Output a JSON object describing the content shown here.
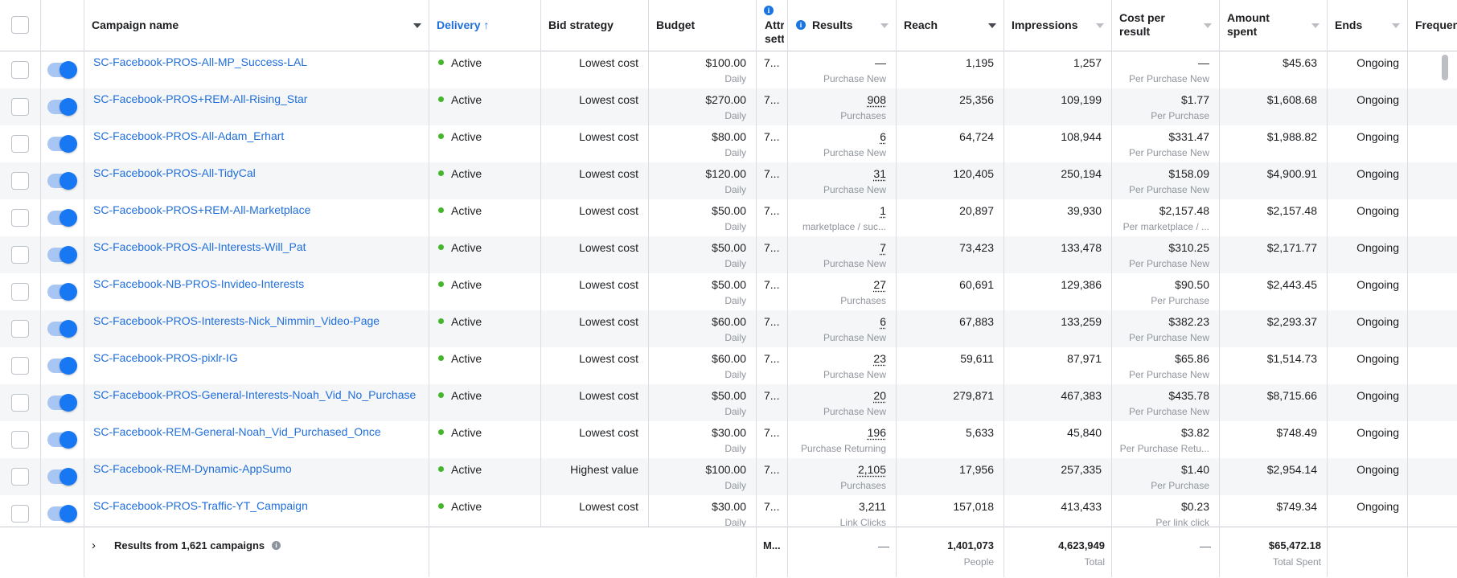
{
  "header": {
    "campaign_name": "Campaign name",
    "delivery": "Delivery",
    "delivery_arrow": "↑",
    "bid_strategy": "Bid strategy",
    "budget": "Budget",
    "attribution_l1": "Attr",
    "attribution_l2": "sett",
    "results": "Results",
    "reach": "Reach",
    "impressions": "Impressions",
    "cost_per_result_l1": "Cost per",
    "cost_per_result_l2": "result",
    "amount_spent_l1": "Amount",
    "amount_spent_l2": "spent",
    "ends": "Ends",
    "frequency": "Frequen",
    "info_glyph": "i"
  },
  "rows": [
    {
      "name": "SC-Facebook-PROS-All-MP_Success-LAL",
      "delivery": "Active",
      "bid": "Lowest cost",
      "budget": "$100.00",
      "budget_type": "Daily",
      "attr": "7...",
      "results": "—",
      "results_sub": "Purchase New",
      "reach": "1,195",
      "impressions": "1,257",
      "cpr": "—",
      "cpr_sub": "Per Purchase New",
      "spent": "$45.63",
      "ends": "Ongoing"
    },
    {
      "name": "SC-Facebook-PROS+REM-All-Rising_Star",
      "delivery": "Active",
      "bid": "Lowest cost",
      "budget": "$270.00",
      "budget_type": "Daily",
      "attr": "7...",
      "results": "908",
      "results_sub": "Purchases",
      "reach": "25,356",
      "impressions": "109,199",
      "cpr": "$1.77",
      "cpr_sub": "Per Purchase",
      "spent": "$1,608.68",
      "ends": "Ongoing"
    },
    {
      "name": "SC-Facebook-PROS-All-Adam_Erhart",
      "delivery": "Active",
      "bid": "Lowest cost",
      "budget": "$80.00",
      "budget_type": "Daily",
      "attr": "7...",
      "results": "6",
      "results_sub": "Purchase New",
      "reach": "64,724",
      "impressions": "108,944",
      "cpr": "$331.47",
      "cpr_sub": "Per Purchase New",
      "spent": "$1,988.82",
      "ends": "Ongoing"
    },
    {
      "name": "SC-Facebook-PROS-All-TidyCal",
      "delivery": "Active",
      "bid": "Lowest cost",
      "budget": "$120.00",
      "budget_type": "Daily",
      "attr": "7...",
      "results": "31",
      "results_sub": "Purchase New",
      "reach": "120,405",
      "impressions": "250,194",
      "cpr": "$158.09",
      "cpr_sub": "Per Purchase New",
      "spent": "$4,900.91",
      "ends": "Ongoing"
    },
    {
      "name": "SC-Facebook-PROS+REM-All-Marketplace",
      "delivery": "Active",
      "bid": "Lowest cost",
      "budget": "$50.00",
      "budget_type": "Daily",
      "attr": "7...",
      "results": "1",
      "results_sub": "marketplace / suc...",
      "reach": "20,897",
      "impressions": "39,930",
      "cpr": "$2,157.48",
      "cpr_sub": "Per marketplace / ...",
      "spent": "$2,157.48",
      "ends": "Ongoing"
    },
    {
      "name": "SC-Facebook-PROS-All-Interests-Will_Pat",
      "delivery": "Active",
      "bid": "Lowest cost",
      "budget": "$50.00",
      "budget_type": "Daily",
      "attr": "7...",
      "results": "7",
      "results_sub": "Purchase New",
      "reach": "73,423",
      "impressions": "133,478",
      "cpr": "$310.25",
      "cpr_sub": "Per Purchase New",
      "spent": "$2,171.77",
      "ends": "Ongoing"
    },
    {
      "name": "SC-Facebook-NB-PROS-Invideo-Interests",
      "delivery": "Active",
      "bid": "Lowest cost",
      "budget": "$50.00",
      "budget_type": "Daily",
      "attr": "7...",
      "results": "27",
      "results_sub": "Purchases",
      "reach": "60,691",
      "impressions": "129,386",
      "cpr": "$90.50",
      "cpr_sub": "Per Purchase",
      "spent": "$2,443.45",
      "ends": "Ongoing"
    },
    {
      "name": "SC-Facebook-PROS-Interests-Nick_Nimmin_Video-Page",
      "delivery": "Active",
      "bid": "Lowest cost",
      "budget": "$60.00",
      "budget_type": "Daily",
      "attr": "7...",
      "results": "6",
      "results_sub": "Purchase New",
      "reach": "67,883",
      "impressions": "133,259",
      "cpr": "$382.23",
      "cpr_sub": "Per Purchase New",
      "spent": "$2,293.37",
      "ends": "Ongoing"
    },
    {
      "name": "SC-Facebook-PROS-pixlr-IG",
      "delivery": "Active",
      "bid": "Lowest cost",
      "budget": "$60.00",
      "budget_type": "Daily",
      "attr": "7...",
      "results": "23",
      "results_sub": "Purchase New",
      "reach": "59,611",
      "impressions": "87,971",
      "cpr": "$65.86",
      "cpr_sub": "Per Purchase New",
      "spent": "$1,514.73",
      "ends": "Ongoing"
    },
    {
      "name": "SC-Facebook-PROS-General-Interests-Noah_Vid_No_Purchase",
      "delivery": "Active",
      "bid": "Lowest cost",
      "budget": "$50.00",
      "budget_type": "Daily",
      "attr": "7...",
      "results": "20",
      "results_sub": "Purchase New",
      "reach": "279,871",
      "impressions": "467,383",
      "cpr": "$435.78",
      "cpr_sub": "Per Purchase New",
      "spent": "$8,715.66",
      "ends": "Ongoing"
    },
    {
      "name": "SC-Facebook-REM-General-Noah_Vid_Purchased_Once",
      "delivery": "Active",
      "bid": "Lowest cost",
      "budget": "$30.00",
      "budget_type": "Daily",
      "attr": "7...",
      "results": "196",
      "results_sub": "Purchase Returning",
      "reach": "5,633",
      "impressions": "45,840",
      "cpr": "$3.82",
      "cpr_sub": "Per Purchase Retu...",
      "spent": "$748.49",
      "ends": "Ongoing"
    },
    {
      "name": "SC-Facebook-REM-Dynamic-AppSumo",
      "delivery": "Active",
      "bid": "Highest value",
      "budget": "$100.00",
      "budget_type": "Daily",
      "attr": "7...",
      "results": "2,105",
      "results_sub": "Purchases",
      "reach": "17,956",
      "impressions": "257,335",
      "cpr": "$1.40",
      "cpr_sub": "Per Purchase",
      "spent": "$2,954.14",
      "ends": "Ongoing"
    },
    {
      "name": "SC-Facebook-PROS-Traffic-YT_Campaign",
      "delivery": "Active",
      "bid": "Lowest cost",
      "budget": "$30.00",
      "budget_type": "Daily",
      "attr": "7...",
      "results": "3,211",
      "results_sub": "Link Clicks",
      "reach": "157,018",
      "impressions": "413,433",
      "cpr": "$0.23",
      "cpr_sub": "Per link click",
      "spent": "$749.34",
      "ends": "Ongoing"
    }
  ],
  "footer": {
    "label": "Results from 1,621 campaigns",
    "attr": "M...",
    "results": "—",
    "reach": "1,401,073",
    "reach_sub": "People",
    "impressions": "4,623,949",
    "impressions_sub": "Total",
    "cpr": "—",
    "spent": "$65,472.18",
    "spent_sub": "Total Spent",
    "info_glyph": "i",
    "chevron": "›"
  },
  "colors": {
    "link": "#216fdb",
    "active_dot": "#42b72a",
    "toggle_on": "#1877f2",
    "alt_row": "#f5f6f7"
  }
}
